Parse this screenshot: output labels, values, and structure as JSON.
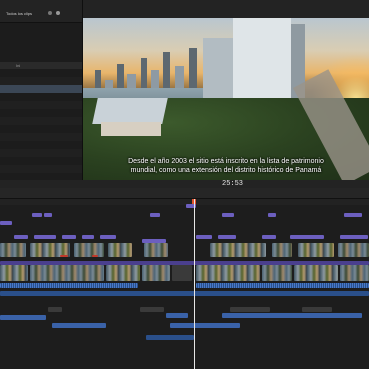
{
  "browser": {
    "tabs": [
      "Todos los clips"
    ],
    "column_header": "Ini",
    "rows": [
      {
        "a": "",
        "b": "",
        "c": ""
      },
      {
        "a": "",
        "b": "",
        "c": ""
      },
      {
        "a": "",
        "b": "",
        "c": ""
      },
      {
        "a": "",
        "b": "",
        "c": ""
      },
      {
        "a": "",
        "b": "",
        "c": ""
      },
      {
        "a": "",
        "b": "",
        "c": ""
      },
      {
        "a": "",
        "b": "",
        "c": ""
      },
      {
        "a": "",
        "b": "",
        "c": ""
      },
      {
        "a": "",
        "b": "",
        "c": ""
      },
      {
        "a": "",
        "b": "",
        "c": ""
      },
      {
        "a": "",
        "b": "",
        "c": ""
      },
      {
        "a": "",
        "b": "",
        "c": ""
      },
      {
        "a": "",
        "b": "",
        "c": ""
      },
      {
        "a": "",
        "b": "",
        "c": ""
      }
    ]
  },
  "viewer": {
    "left_label": "",
    "title": "",
    "zoom": "",
    "display_label": "",
    "subtitle_line1": "Desde el año 2003 el sitio está inscrito en la lista de patrimonio",
    "subtitle_line2": "mundial, como una extensión del distrito histórico de Panamá",
    "timecode": "25:53"
  },
  "timeline": {
    "project_name": "",
    "duration": ""
  },
  "colors": {
    "accent_playhead": "#e0522c",
    "title_clip": "#6c5fbf",
    "audio_clip": "#2a4f8a",
    "selected_row": "#3b4756"
  }
}
